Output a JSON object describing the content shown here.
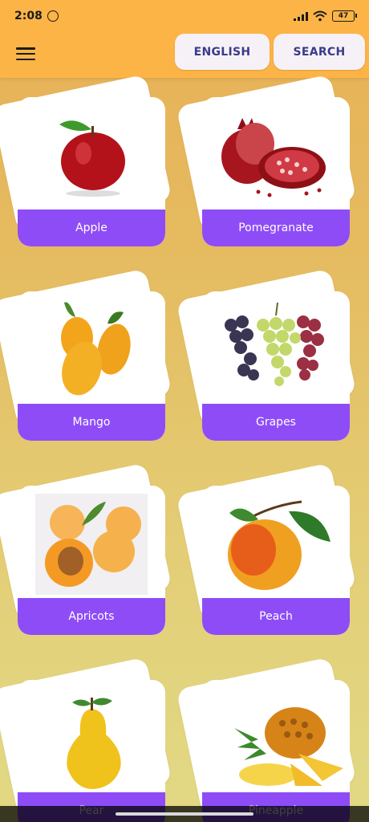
{
  "status_bar": {
    "time": "2:08",
    "battery": "47"
  },
  "app_bar": {
    "language_button": "ENGLISH",
    "search_button": "SEARCH"
  },
  "cards": [
    {
      "label": "Apple"
    },
    {
      "label": "Pomegranate"
    },
    {
      "label": "Mango"
    },
    {
      "label": "Grapes"
    },
    {
      "label": "Apricots"
    },
    {
      "label": "Peach"
    },
    {
      "label": "Pear"
    },
    {
      "label": "Pineapple"
    }
  ],
  "colors": {
    "app_bar": "#fdb447",
    "label_bg": "#8e4cf7",
    "button_text": "#3b3a8a"
  }
}
